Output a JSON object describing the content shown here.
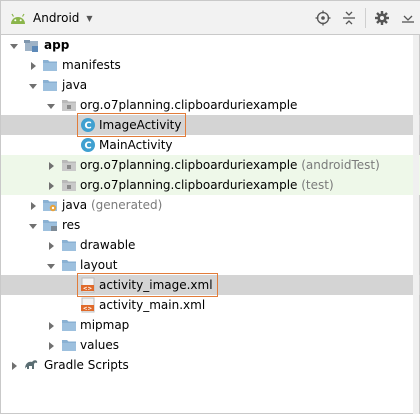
{
  "toolbar": {
    "title": "Android",
    "icons": [
      "android-icon",
      "dropdown-caret-icon",
      "locate-target-icon",
      "collapse-all-icon",
      "settings-gear-icon",
      "hide-panel-icon"
    ]
  },
  "tree": [
    {
      "label": "app",
      "suffix": "",
      "icon": "module-icon",
      "expand": "down",
      "bold": true
    },
    {
      "label": "manifests",
      "suffix": "",
      "icon": "folder-icon",
      "expand": "right"
    },
    {
      "label": "java",
      "suffix": "",
      "icon": "folder-icon",
      "expand": "down"
    },
    {
      "label": "org.o7planning.clipboarduriexample",
      "suffix": "",
      "icon": "package-icon",
      "expand": "down"
    },
    {
      "label": "ImageActivity",
      "suffix": "",
      "icon": "class-icon",
      "expand": "none",
      "selected": true
    },
    {
      "label": "MainActivity",
      "suffix": "",
      "icon": "class-icon",
      "expand": "none"
    },
    {
      "label": "org.o7planning.clipboarduriexample",
      "suffix": " (androidTest)",
      "icon": "package-icon",
      "expand": "right",
      "test": true
    },
    {
      "label": "org.o7planning.clipboarduriexample",
      "suffix": " (test)",
      "icon": "package-icon",
      "expand": "right",
      "test": true
    },
    {
      "label": "java",
      "suffix": " (generated)",
      "icon": "generated-folder-icon",
      "expand": "right"
    },
    {
      "label": "res",
      "suffix": "",
      "icon": "res-folder-icon",
      "expand": "down"
    },
    {
      "label": "drawable",
      "suffix": "",
      "icon": "folder-icon",
      "expand": "right"
    },
    {
      "label": "layout",
      "suffix": "",
      "icon": "folder-icon",
      "expand": "down"
    },
    {
      "label": "activity_image.xml",
      "suffix": "",
      "icon": "xml-file-icon",
      "expand": "none",
      "selected": true
    },
    {
      "label": "activity_main.xml",
      "suffix": "",
      "icon": "xml-file-icon",
      "expand": "none"
    },
    {
      "label": "mipmap",
      "suffix": "",
      "icon": "folder-icon",
      "expand": "right"
    },
    {
      "label": "values",
      "suffix": "",
      "icon": "folder-icon",
      "expand": "right"
    },
    {
      "label": "Gradle Scripts",
      "suffix": "",
      "icon": "gradle-icon",
      "expand": "right"
    }
  ],
  "highlighted": [
    "ImageActivity",
    "activity_image.xml"
  ],
  "colors": {
    "selection": "#d4d4d4",
    "test_row": "#eef8e9",
    "highlight_border": "#e27c3a",
    "folder": "#8ab1d3",
    "class": "#40a0d0"
  }
}
